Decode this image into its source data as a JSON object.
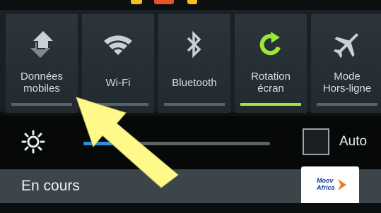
{
  "quick_settings": [
    {
      "label": "Données mobiles",
      "icon": "mobile-data-icon",
      "active": false
    },
    {
      "label": "Wi-Fi",
      "icon": "wifi-icon",
      "active": false
    },
    {
      "label": "Bluetooth",
      "icon": "bluetooth-icon",
      "active": false
    },
    {
      "label": "Rotation écran",
      "icon": "rotation-icon",
      "active": true
    },
    {
      "label": "Mode Hors-ligne",
      "icon": "airplane-icon",
      "active": false
    }
  ],
  "labels": {
    "t0a": "Données",
    "t0b": "mobiles",
    "t1": "Wi-Fi",
    "t2": "Bluetooth",
    "t3a": "Rotation",
    "t3b": "écran",
    "t4a": "Mode",
    "t4b": "Hors-ligne"
  },
  "brightness": {
    "level": 0.3,
    "auto_label": "Auto",
    "auto_checked": false
  },
  "notifications": {
    "section_title": "En cours"
  },
  "logo": {
    "line1": "Moov",
    "line2": "Africa"
  },
  "colors": {
    "active_bar": "#9ce835",
    "inactive_bar": "#56636b",
    "slider": "#2b8ee0",
    "annotation_arrow": "#fff98a"
  }
}
